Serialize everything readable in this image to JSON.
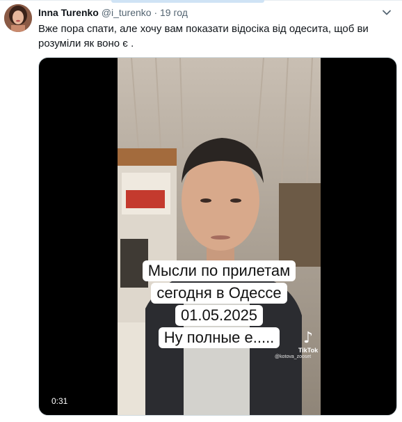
{
  "tweet": {
    "author_name": "Inna Turenko",
    "handle": "@i_turenko",
    "separator": "·",
    "time": "19 год",
    "text": "Вже пора спати, але хочу вам показати відосіка від одесита, щоб ви розуміли як воно є .",
    "menu_icon": "chevron-down-icon"
  },
  "video": {
    "caption_lines": [
      "Мысли по прилетам",
      "сегодня в Одессе",
      "01.05.2025",
      "Ну полные е....."
    ],
    "tiktok_brand": "TikTok",
    "tiktok_logo": "♪",
    "tiktok_user": "@kotova_zooset",
    "duration": "0:31"
  },
  "colors": {
    "text_primary": "#0f1419",
    "text_secondary": "#536471",
    "media_border": "#cfd9de"
  }
}
